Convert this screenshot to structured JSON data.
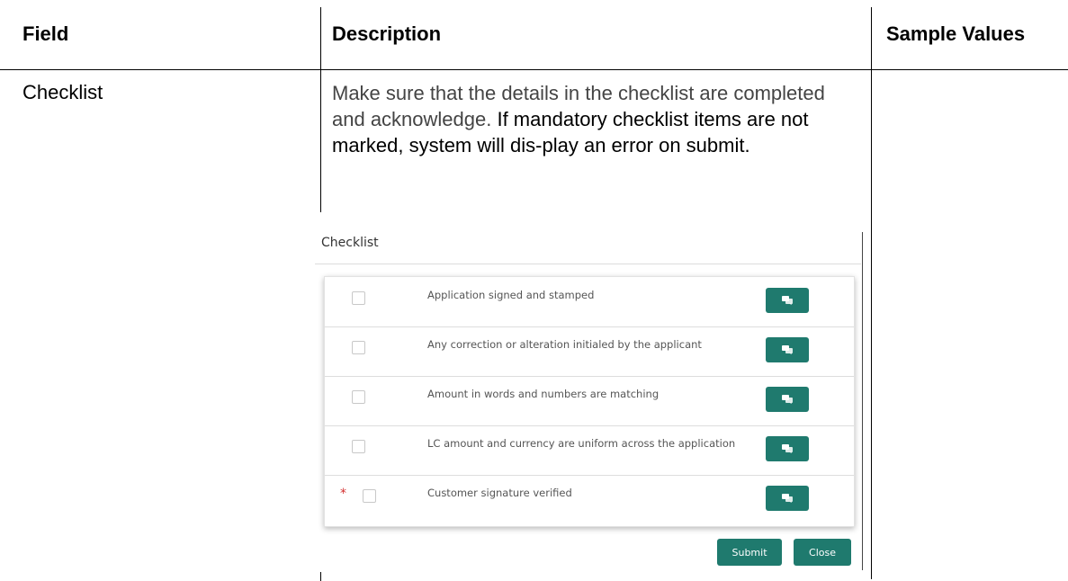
{
  "table": {
    "headers": [
      "Field",
      "Description",
      "Sample Values"
    ],
    "row": {
      "field": "Checklist",
      "description_part1": "Make sure that the details in the checklist are completed and acknowledge.",
      "description_part2": " If mandatory checklist items are not marked, system will dis-play an error on submit."
    }
  },
  "checklist": {
    "title": "Checklist",
    "items": [
      {
        "label": "Application signed and stamped",
        "mandatory": false,
        "checked": false
      },
      {
        "label": "Any correction or alteration initialed by the applicant",
        "mandatory": false,
        "checked": false
      },
      {
        "label": "Amount in words and numbers are matching",
        "mandatory": false,
        "checked": false
      },
      {
        "label": "LC amount and currency are uniform across the application",
        "mandatory": false,
        "checked": false
      },
      {
        "label": "Customer signature verified",
        "mandatory": true,
        "checked": false
      }
    ],
    "mandatory_marker": "*",
    "comment_icon": "comment-icon",
    "submit_label": "Submit",
    "close_label": "Close",
    "accent_color": "#1f7a6e"
  }
}
